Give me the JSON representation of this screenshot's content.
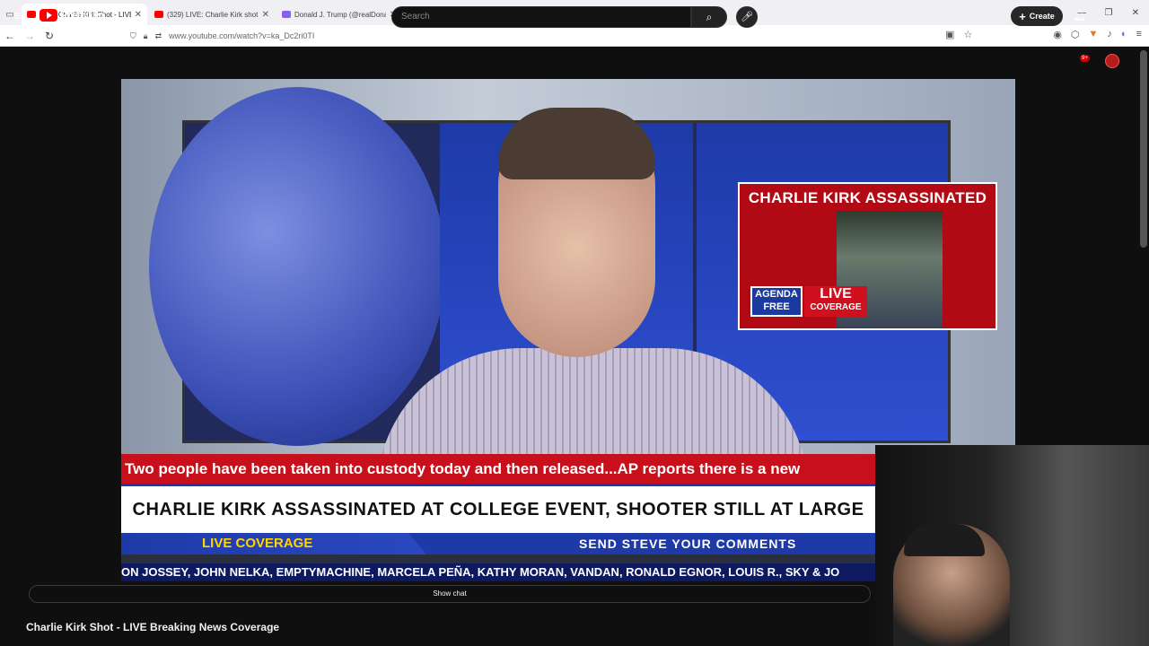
{
  "browser": {
    "tabs": [
      {
        "title": "(329) Charlie Kirk Shot - LIVE Br",
        "active": true,
        "favicon_color": "#ff0000"
      },
      {
        "title": "(329) LIVE: Charlie Kirk shot and",
        "active": false,
        "favicon_color": "#ff0000"
      },
      {
        "title": "Donald J. Trump (@realDonaldT",
        "active": false,
        "favicon_color": "#8a5cf6"
      }
    ],
    "url": "www.youtube.com/watch?v=ka_Dc2ri0TI"
  },
  "youtube": {
    "logo_text": "Premium",
    "search_placeholder": "Search",
    "create_label": "Create",
    "notification_badge": "9+"
  },
  "video": {
    "inset_title": "CHARLIE KIRK ASSASSINATED",
    "inset_logo": "AGENDA FREE",
    "inset_live": "LIVE",
    "inset_coverage": "COVERAGE",
    "ticker_red": "Two people have been taken into custody today and then released...AP reports there is a new",
    "headline": "CHARLIE KIRK ASSASSINATED AT COLLEGE EVENT, SHOOTER STILL AT LARGE",
    "live_coverage": "LIVE COVERAGE",
    "send_comments": "SEND STEVE YOUR COMMENTS",
    "names_crawl": "ON JOSSEY, JOHN NELKA, EMPTYMACHINE, MARCELA PEÑA, KATHY MORAN, VANDAN, RONALD EGNOR, LOUIS R., SKY & JO"
  },
  "page": {
    "show_chat": "Show chat",
    "video_title": "Charlie Kirk Shot - LIVE Breaking News Coverage"
  },
  "colors": {
    "yt_red": "#ff0000",
    "ticker_red": "#c8101c",
    "news_blue": "#1e3aa8",
    "live_yellow": "#ffd400"
  }
}
